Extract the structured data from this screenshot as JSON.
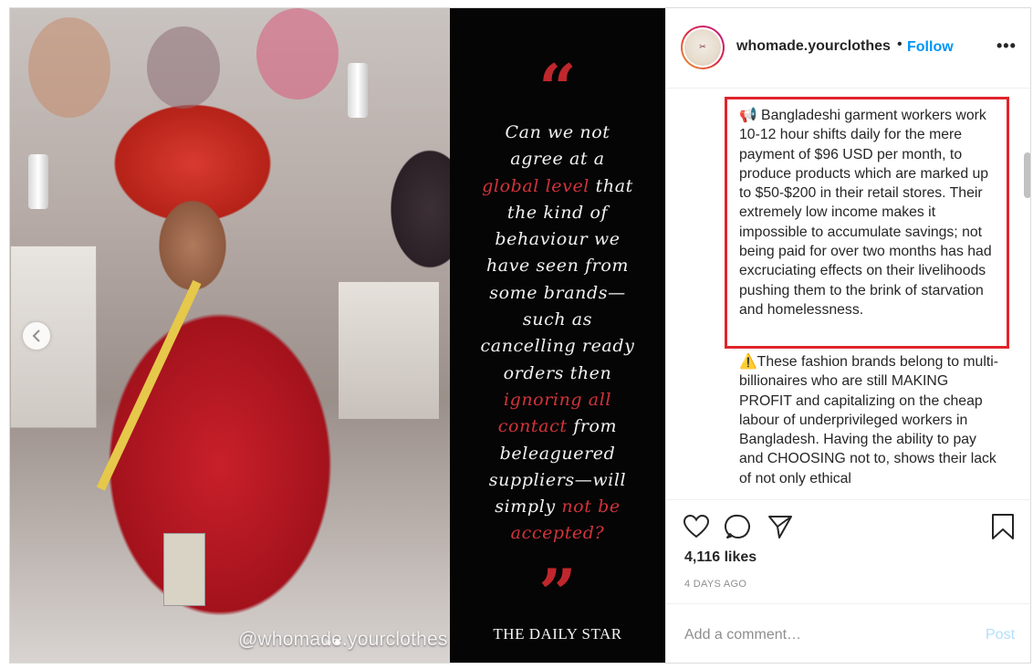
{
  "media": {
    "watermark": "@whomade.yourclothes",
    "quote_open": "“",
    "quote_close": "”",
    "quote_lines": [
      [
        {
          "t": "Can we not",
          "hl": false
        }
      ],
      [
        {
          "t": "agree at a",
          "hl": false
        }
      ],
      [
        {
          "t": "global level",
          "hl": true
        },
        {
          "t": " that",
          "hl": false
        }
      ],
      [
        {
          "t": "the kind of",
          "hl": false
        }
      ],
      [
        {
          "t": "behaviour we",
          "hl": false
        }
      ],
      [
        {
          "t": "have seen from",
          "hl": false
        }
      ],
      [
        {
          "t": "some brands—",
          "hl": false
        }
      ],
      [
        {
          "t": "such as",
          "hl": false
        }
      ],
      [
        {
          "t": "cancelling ready",
          "hl": false
        }
      ],
      [
        {
          "t": "orders then",
          "hl": false
        }
      ],
      [
        {
          "t": "ignoring all",
          "hl": true
        }
      ],
      [
        {
          "t": "contact",
          "hl": true
        },
        {
          "t": " from",
          "hl": false
        }
      ],
      [
        {
          "t": "beleaguered",
          "hl": false
        }
      ],
      [
        {
          "t": "suppliers—will",
          "hl": false
        }
      ],
      [
        {
          "t": "simply ",
          "hl": false
        },
        {
          "t": "not be",
          "hl": true
        }
      ],
      [
        {
          "t": "accepted?",
          "hl": true
        }
      ]
    ],
    "source": "THE DAILY STAR",
    "carousel": {
      "count": 2,
      "active": 1
    }
  },
  "header": {
    "username": "whomade.yourclothes",
    "separator": "•",
    "follow_label": "Follow",
    "more_label": "•••"
  },
  "caption": {
    "p1_icon": "📢",
    "p1_text": " Bangladeshi garment workers work 10-12 hour shifts daily for the mere payment of $96 USD per month, to produce products which are marked up to $50-$200 in their retail stores. Their extremely low income makes it impossible to accumulate savings; not being paid for over two months has had excruciating effects on their livelihoods pushing them to the brink of starvation and homelessness.",
    "p2_icon": "⚠️",
    "p2_text": "These fashion brands belong to multi-billionaires who are still MAKING PROFIT and capitalizing on the cheap labour of underprivileged workers in Bangladesh. Having the ability to pay and CHOOSING not to, shows their lack of not only ethical"
  },
  "actions": {
    "icons": [
      "heart-icon",
      "comment-icon",
      "share-icon",
      "bookmark-icon"
    ],
    "likes": "4,116 likes",
    "date": "4 DAYS AGO"
  },
  "comment": {
    "placeholder": "Add a comment…",
    "post_label": "Post"
  },
  "colors": {
    "highlight_box": "#e0242c",
    "follow": "#0095f6",
    "quote_accent": "#c0272d"
  }
}
